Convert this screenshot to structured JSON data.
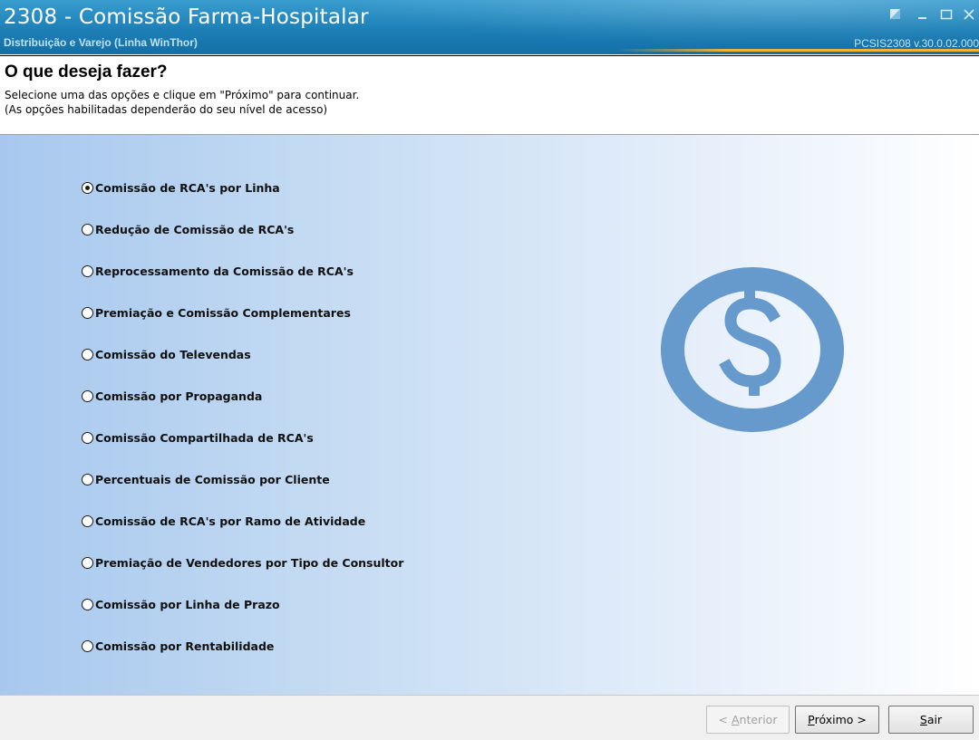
{
  "window": {
    "title": "2308 - Comissão Farma-Hospitalar",
    "subtitle": "Distribuição e Varejo (Linha WinThor)",
    "version": "PCSIS2308  v.30.0.02.000",
    "controls": [
      "restore-icon",
      "minimize-icon",
      "maximize-icon",
      "close-icon"
    ]
  },
  "header": {
    "title": "O que deseja fazer?",
    "line1": "Selecione uma das opções e clique em \"Próximo\" para continuar.",
    "line2": "(As opções habilitadas dependerão do seu nível de acesso)"
  },
  "options": [
    {
      "label": "Comissão de RCA's por Linha",
      "checked": true
    },
    {
      "label": "Redução de Comissão de RCA's",
      "checked": false
    },
    {
      "label": "Reprocessamento da Comissão de RCA's",
      "checked": false
    },
    {
      "label": "Premiação e Comissão Complementares",
      "checked": false
    },
    {
      "label": "Comissão do Televendas",
      "checked": false
    },
    {
      "label": "Comissão por Propaganda",
      "checked": false
    },
    {
      "label": "Comissão Compartilhada de RCA's",
      "checked": false
    },
    {
      "label": "Percentuais de Comissão por Cliente",
      "checked": false
    },
    {
      "label": "Comissão de RCA's por Ramo de Atividade",
      "checked": false
    },
    {
      "label": "Premiação de Vendedores por Tipo de Consultor",
      "checked": false
    },
    {
      "label": "Comissão por Linha de Prazo",
      "checked": false
    },
    {
      "label": "Comissão por Rentabilidade",
      "checked": false
    }
  ],
  "illustration": {
    "icon": "dollar-coin-icon",
    "color": "#6699cc"
  },
  "footer": {
    "prev": {
      "mnemonic": "A",
      "rest": "nterior",
      "prefix": "< ",
      "suffix": "",
      "disabled": true
    },
    "next": {
      "mnemonic": "P",
      "rest": "róximo",
      "prefix": "",
      "suffix": " >",
      "disabled": false
    },
    "exit": {
      "mnemonic": "S",
      "rest": "air",
      "prefix": "",
      "suffix": "",
      "disabled": false
    }
  },
  "colors": {
    "titlebar": "#1c7fb6",
    "accent": "#f2b233",
    "content_gradient_start": "#a7c8ee",
    "content_gradient_end": "#ffffff"
  }
}
